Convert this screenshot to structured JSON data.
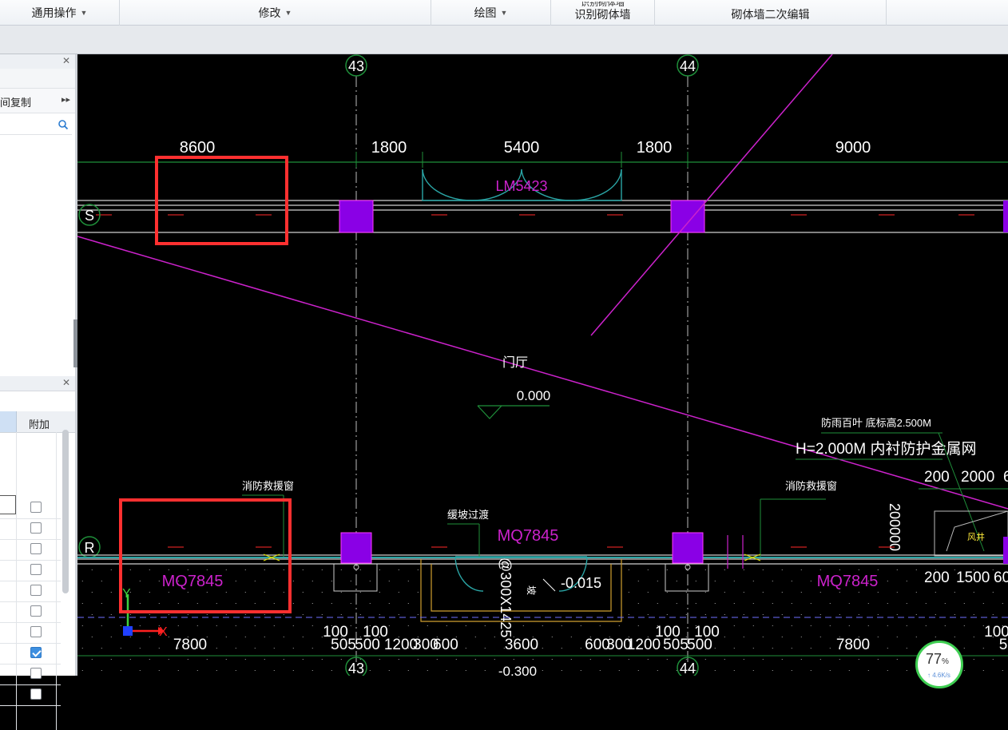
{
  "ribbon": {
    "groups": [
      {
        "label": "通用操作"
      },
      {
        "label": "修改"
      },
      {
        "label": "绘图"
      },
      {
        "label": "识别砌体墙",
        "ghost": "识别砌体墙"
      },
      {
        "label": "砌体墙二次编辑"
      }
    ]
  },
  "left_panel": {
    "copy_label": "间复制",
    "more_icon": "double-chevron-right",
    "table_header": "附加",
    "checkbox_states": [
      false,
      false,
      false,
      false,
      false,
      false,
      false,
      true,
      false,
      false
    ]
  },
  "cad": {
    "axis_top": [
      "43",
      "44"
    ],
    "axis_bottom": [
      "43",
      "44"
    ],
    "axis_left": [
      "S",
      "R"
    ],
    "dims_top": [
      "8600",
      "1800",
      "5400",
      "1800",
      "9000"
    ],
    "dims_bottom": [
      "7800",
      "100",
      "100",
      "505",
      "500",
      "1200",
      "300",
      "600",
      "3600",
      "600",
      "300",
      "1200",
      "505",
      "500",
      "100",
      "100",
      "7800",
      "100",
      "5"
    ],
    "door_label": "LM5423",
    "wall_labels": [
      "MQ7845",
      "MQ7845",
      "MQ7845"
    ],
    "room_label": "门厅",
    "elevation": "0.000",
    "elev_low": "-0.015",
    "elev_bottom": "-0.300",
    "ramp_text": "@300X1425",
    "slope_text": "坡",
    "notes": [
      "消防救援窗",
      "消防救援窗",
      "缓坡过渡"
    ],
    "louver_note": "防雨百叶 底标高2.500M",
    "height_note": "H=2.000M 内衬防护金属网",
    "right_dims": [
      "200",
      "2000",
      "6"
    ],
    "right_dims2": [
      "200",
      "1500",
      "60"
    ],
    "vertical_dim": "200000",
    "shaft_label": "风井",
    "ucs_x": "X",
    "ucs_y": "Y"
  },
  "status": {
    "percent": "77",
    "percent_sign": "%",
    "rate": "↑ 4.6K/s"
  },
  "colors": {
    "magenta": "#cc22cc",
    "column": "#8a00e6",
    "green": "#1f8f3a",
    "highlight": "#ff3030"
  }
}
